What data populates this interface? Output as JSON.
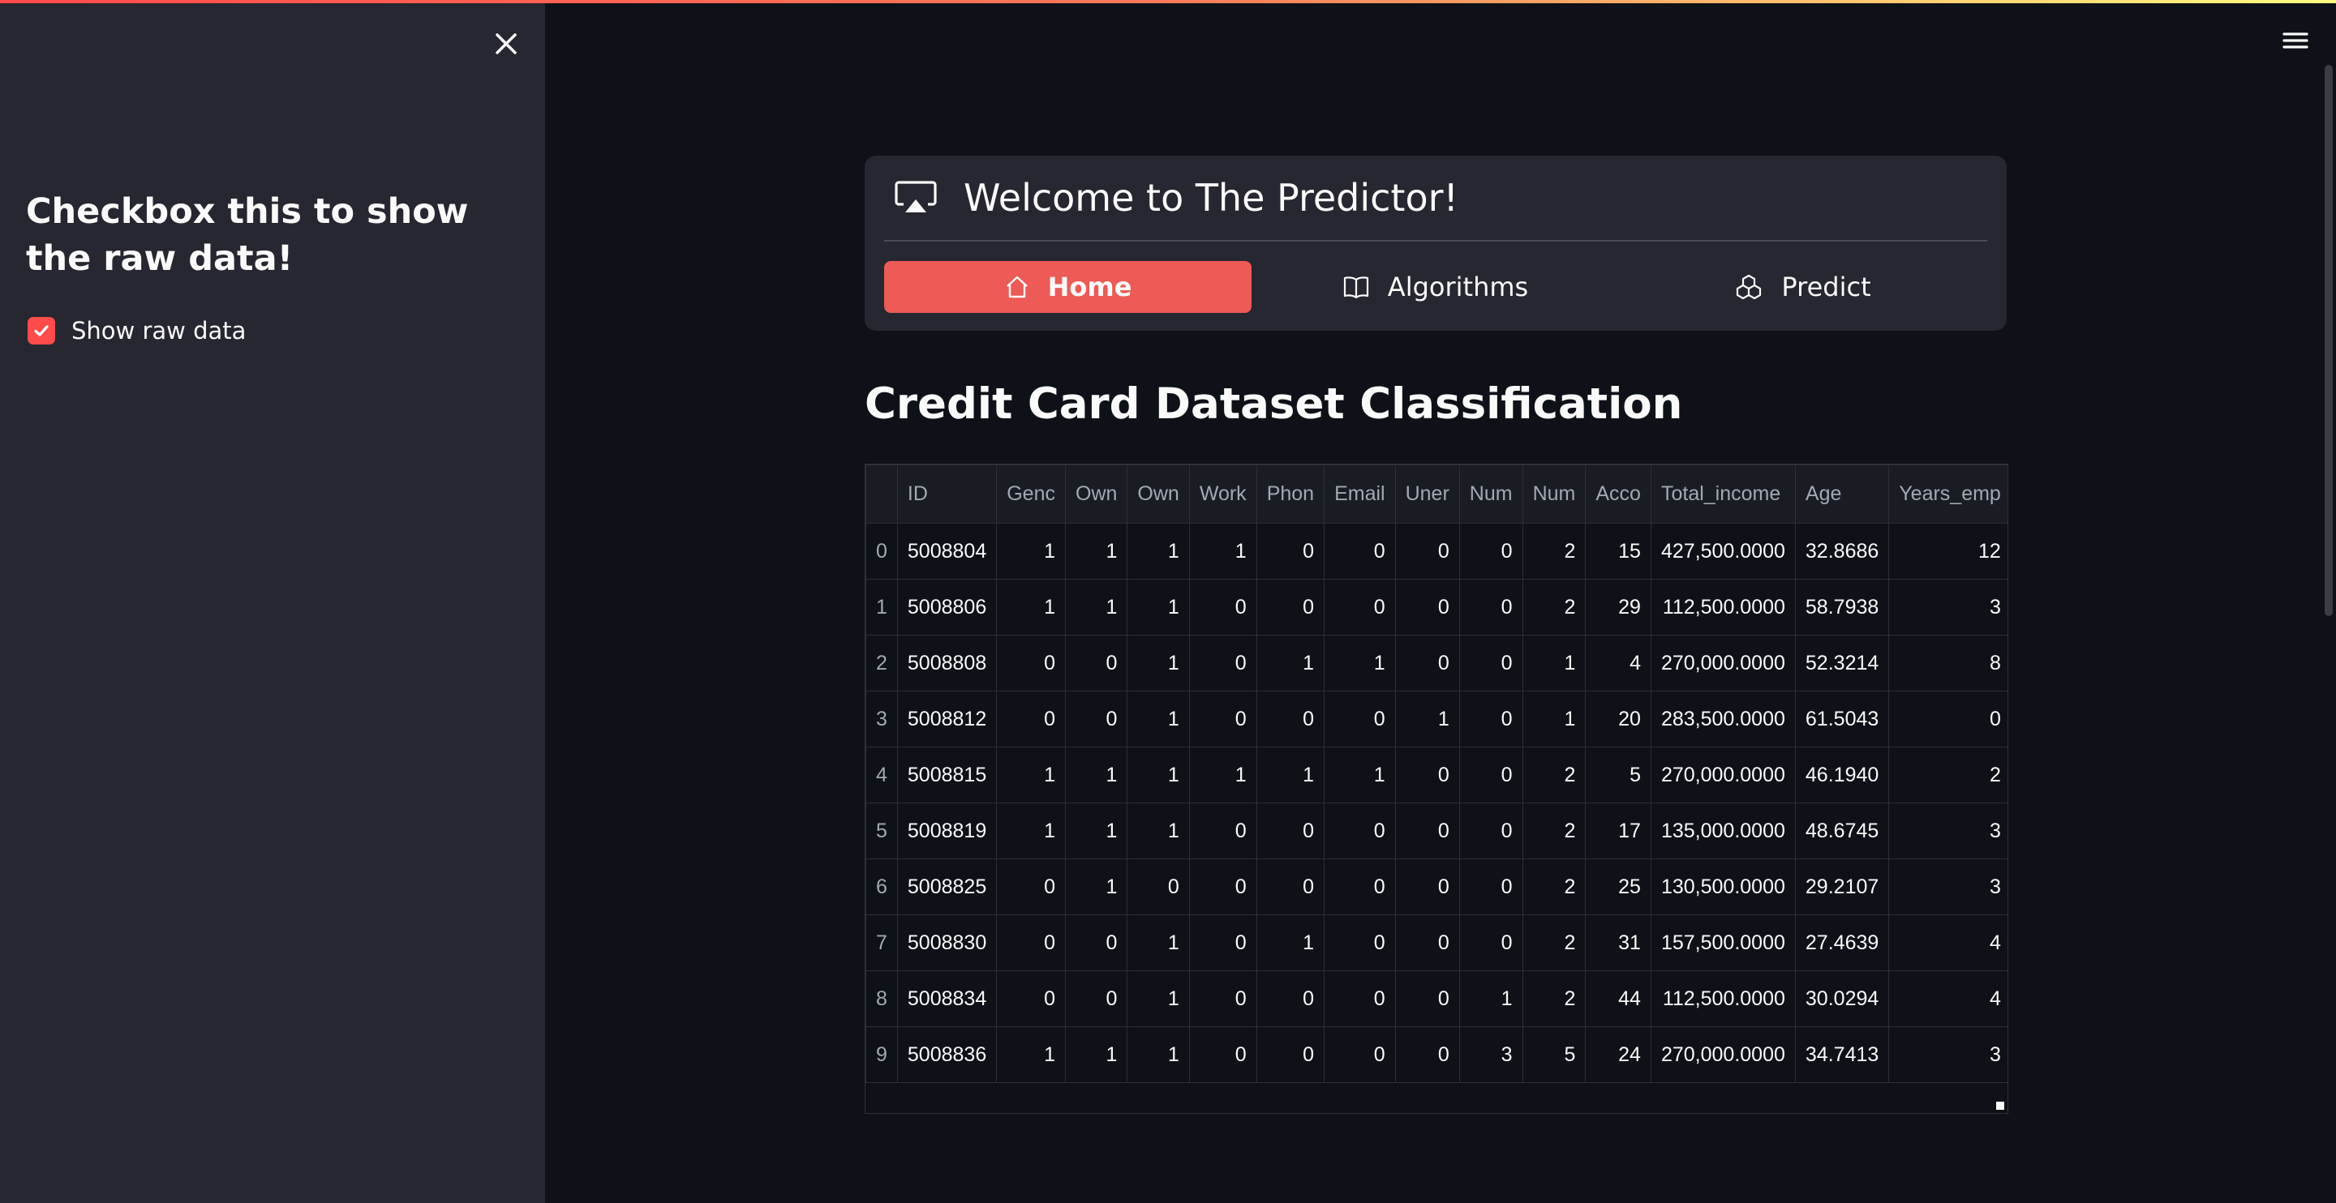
{
  "sidebar": {
    "heading": "Checkbox this to show the raw data!",
    "checkbox_label": "Show raw data",
    "checkbox_checked": true
  },
  "nav": {
    "title": "Welcome to The Predictor!",
    "tabs": [
      {
        "label": "Home",
        "icon": "house-icon",
        "active": true
      },
      {
        "label": "Algorithms",
        "icon": "book-icon",
        "active": false
      },
      {
        "label": "Predict",
        "icon": "boxes-icon",
        "active": false
      }
    ]
  },
  "main": {
    "title": "Credit Card Dataset Classification"
  },
  "table": {
    "columns": [
      "",
      "ID",
      "Genc",
      "Own",
      "Own",
      "Work",
      "Phon",
      "Email",
      "Uner",
      "Num",
      "Num",
      "Acco",
      "Total_income",
      "Age",
      "Years_emp"
    ],
    "rows": [
      [
        "0",
        "5008804",
        "1",
        "1",
        "1",
        "1",
        "0",
        "0",
        "0",
        "0",
        "2",
        "15",
        "427,500.0000",
        "32.8686",
        "12"
      ],
      [
        "1",
        "5008806",
        "1",
        "1",
        "1",
        "0",
        "0",
        "0",
        "0",
        "0",
        "2",
        "29",
        "112,500.0000",
        "58.7938",
        "3"
      ],
      [
        "2",
        "5008808",
        "0",
        "0",
        "1",
        "0",
        "1",
        "1",
        "0",
        "0",
        "1",
        "4",
        "270,000.0000",
        "52.3214",
        "8"
      ],
      [
        "3",
        "5008812",
        "0",
        "0",
        "1",
        "0",
        "0",
        "0",
        "1",
        "0",
        "1",
        "20",
        "283,500.0000",
        "61.5043",
        "0"
      ],
      [
        "4",
        "5008815",
        "1",
        "1",
        "1",
        "1",
        "1",
        "1",
        "0",
        "0",
        "2",
        "5",
        "270,000.0000",
        "46.1940",
        "2"
      ],
      [
        "5",
        "5008819",
        "1",
        "1",
        "1",
        "0",
        "0",
        "0",
        "0",
        "0",
        "2",
        "17",
        "135,000.0000",
        "48.6745",
        "3"
      ],
      [
        "6",
        "5008825",
        "0",
        "1",
        "0",
        "0",
        "0",
        "0",
        "0",
        "0",
        "2",
        "25",
        "130,500.0000",
        "29.2107",
        "3"
      ],
      [
        "7",
        "5008830",
        "0",
        "0",
        "1",
        "0",
        "1",
        "0",
        "0",
        "0",
        "2",
        "31",
        "157,500.0000",
        "27.4639",
        "4"
      ],
      [
        "8",
        "5008834",
        "0",
        "0",
        "1",
        "0",
        "0",
        "0",
        "0",
        "1",
        "2",
        "44",
        "112,500.0000",
        "30.0294",
        "4"
      ],
      [
        "9",
        "5008836",
        "1",
        "1",
        "1",
        "0",
        "0",
        "0",
        "0",
        "3",
        "5",
        "24",
        "270,000.0000",
        "34.7413",
        "3"
      ]
    ]
  },
  "colors": {
    "accent": "#ff4b4b",
    "active_tab": "#ee5a55",
    "sidebar_bg": "#262730",
    "main_bg": "#0e1117"
  }
}
